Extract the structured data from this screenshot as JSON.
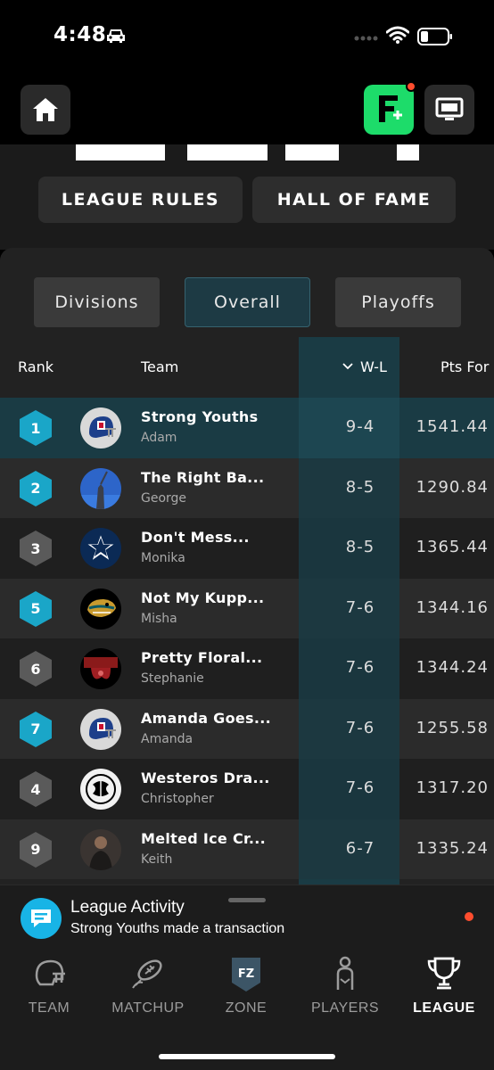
{
  "status_bar": {
    "time": "4:48"
  },
  "header": {
    "league_rules": "LEAGUE RULES",
    "hall_of_fame": "HALL OF FAME"
  },
  "tabs": [
    {
      "label": "Divisions",
      "selected": false
    },
    {
      "label": "Overall",
      "selected": true
    },
    {
      "label": "Playoffs",
      "selected": false
    }
  ],
  "table": {
    "headers": {
      "rank": "Rank",
      "team": "Team",
      "wl": "W-L",
      "pts": "Pts For"
    },
    "rows": [
      {
        "rank": "1",
        "team": "Strong Youths",
        "owner": "Adam",
        "wl": "9-4",
        "pts": "1541.44",
        "hex_color": "#1aa6c8",
        "avatar": "nfl-helmet"
      },
      {
        "rank": "2",
        "team": "The Right Ba...",
        "owner": "George",
        "wl": "8-5",
        "pts": "1290.84",
        "hex_color": "#1aa6c8",
        "avatar": "statue-sky"
      },
      {
        "rank": "3",
        "team": "Don't Mess...",
        "owner": "Monika",
        "wl": "8-5",
        "pts": "1365.44",
        "hex_color": "#5a5a5a",
        "avatar": "cowboys-star"
      },
      {
        "rank": "5",
        "team": "Not My Kupp...",
        "owner": "Misha",
        "wl": "7-6",
        "pts": "1344.16",
        "hex_color": "#1aa6c8",
        "avatar": "jaguar"
      },
      {
        "rank": "6",
        "team": "Pretty Floral...",
        "owner": "Stephanie",
        "wl": "7-6",
        "pts": "1344.24",
        "hex_color": "#5a5a5a",
        "avatar": "floral-crown"
      },
      {
        "rank": "7",
        "team": "Amanda Goes...",
        "owner": "Amanda",
        "wl": "7-6",
        "pts": "1255.58",
        "hex_color": "#1aa6c8",
        "avatar": "nfl-helmet"
      },
      {
        "rank": "4",
        "team": "Westeros Dra...",
        "owner": "Christopher",
        "wl": "7-6",
        "pts": "1317.20",
        "hex_color": "#5a5a5a",
        "avatar": "dragon-sigil"
      },
      {
        "rank": "9",
        "team": "Melted Ice Cr...",
        "owner": "Keith",
        "wl": "6-7",
        "pts": "1335.24",
        "hex_color": "#5a5a5a",
        "avatar": "person-photo"
      }
    ]
  },
  "activity": {
    "title": "League Activity",
    "subtitle": "Strong Youths made a transaction"
  },
  "nav": [
    {
      "label": "TEAM",
      "icon": "helmet-icon",
      "active": false
    },
    {
      "label": "MATCHUP",
      "icon": "football-icon",
      "active": false
    },
    {
      "label": "ZONE",
      "icon": "fz-shield-icon",
      "active": false,
      "badge": "FZ"
    },
    {
      "label": "PLAYERS",
      "icon": "player-icon",
      "active": false
    },
    {
      "label": "LEAGUE",
      "icon": "trophy-icon",
      "active": true
    }
  ],
  "colors": {
    "accent": "#1aa6c8",
    "green": "#1ddc6a",
    "alert": "#ff4d2e"
  }
}
